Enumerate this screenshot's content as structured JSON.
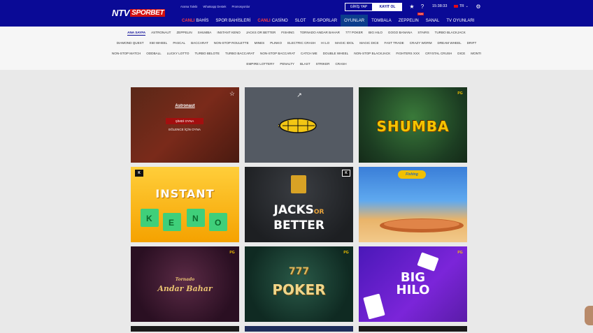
{
  "header": {
    "logo_prefix": "NTV",
    "logo_suffix": "SPORBET",
    "links": [
      "Arama Talebi",
      "Whatsapp Destek",
      "Promosyonlar"
    ],
    "login_label": "GİRİŞ YAP",
    "register_label": "KAYIT OL",
    "time": "15:38:33",
    "language": "TR",
    "colors": {
      "primary": "#0a0a96",
      "accent": "#d20f0f"
    }
  },
  "mainnav": [
    {
      "label": "BAHİS",
      "prefix": "CANLI",
      "active": false
    },
    {
      "label": "SPOR BAHİSLERİ",
      "prefix": "",
      "active": false
    },
    {
      "label": "CASİNO",
      "prefix": "CANLI",
      "active": false
    },
    {
      "label": "SLOT",
      "prefix": "",
      "active": false
    },
    {
      "label": "E-SPORLAR",
      "prefix": "",
      "active": false
    },
    {
      "label": "OYUNLAR",
      "prefix": "",
      "active": true
    },
    {
      "label": "TOMBALA",
      "prefix": "",
      "active": false
    },
    {
      "label": "ZEPPELIN",
      "prefix": "",
      "active": false,
      "badge": "YENİ"
    },
    {
      "label": "SANAL",
      "prefix": "",
      "active": false
    },
    {
      "label": "TV OYUNLARI",
      "prefix": "",
      "active": false
    }
  ],
  "subnav": {
    "row1": [
      "ANA SAYFA",
      "ASTRONAUT",
      "ZEPPELIN",
      "SHUMBA",
      "INSTANT KENO",
      "JACKS OR BETTER",
      "FISHING",
      "TORNADO ANDAR BAHAR",
      "777 POKER",
      "BIG HILO",
      "GOGO BANANA",
      "STAIRS",
      "TURBO BLACKJACK"
    ],
    "row2": [
      "DIAMOND QUEST",
      "X50 WHEEL",
      "PASCAL",
      "BACCARAT",
      "NON-STOP ROULETTE",
      "MINES",
      "PLINKO",
      "ELECTRIC CRASH",
      "HI LO",
      "MAGIC IDOL",
      "MAGIC DICE",
      "FAST TRADE",
      "CRAZY WORM",
      "DREAM WHEEL",
      "DRIFT"
    ],
    "row3": [
      "NON-STOP MATCH",
      "ODDBALL",
      "LUCKY LOTTO",
      "TURBO BELOTE",
      "TURBO BACCARAT",
      "NON-STOP BACCARAT",
      "CATCH ME",
      "DOUBLE WHEEL",
      "NON-STOP BLACKJACK",
      "FIGHTERS XXX",
      "CRYSTAL CRUSH",
      "DICE",
      "MONTI"
    ],
    "row4": [
      "EMPIRE LOTTERY",
      "PENALTY",
      "BLAST",
      "STRIKER",
      "CRASH"
    ]
  },
  "games": {
    "astronaut": {
      "name": "Astronaut",
      "play": "ŞİMDİ OYNA",
      "demo": "EĞLENCE İÇİN OYNA"
    },
    "shumba": {
      "title": "SHUMBA",
      "provider": "PG"
    },
    "keno": {
      "title": "INSTANT",
      "letters": [
        "K",
        "E",
        "N",
        "O"
      ],
      "provider": "K"
    },
    "jacks": {
      "line1a": "JACKS",
      "line1b": "OR",
      "line2": "BETTER",
      "provider": "K"
    },
    "fishing": {
      "logo": "Fishing"
    },
    "andar": {
      "sub": "Tornado",
      "title": "Andar Bahar",
      "provider": "PG"
    },
    "poker": {
      "num": "777",
      "title": "POKER",
      "provider": "PG"
    },
    "hilo": {
      "line1": "BIG",
      "line2": "HILO",
      "provider": "PG"
    }
  }
}
